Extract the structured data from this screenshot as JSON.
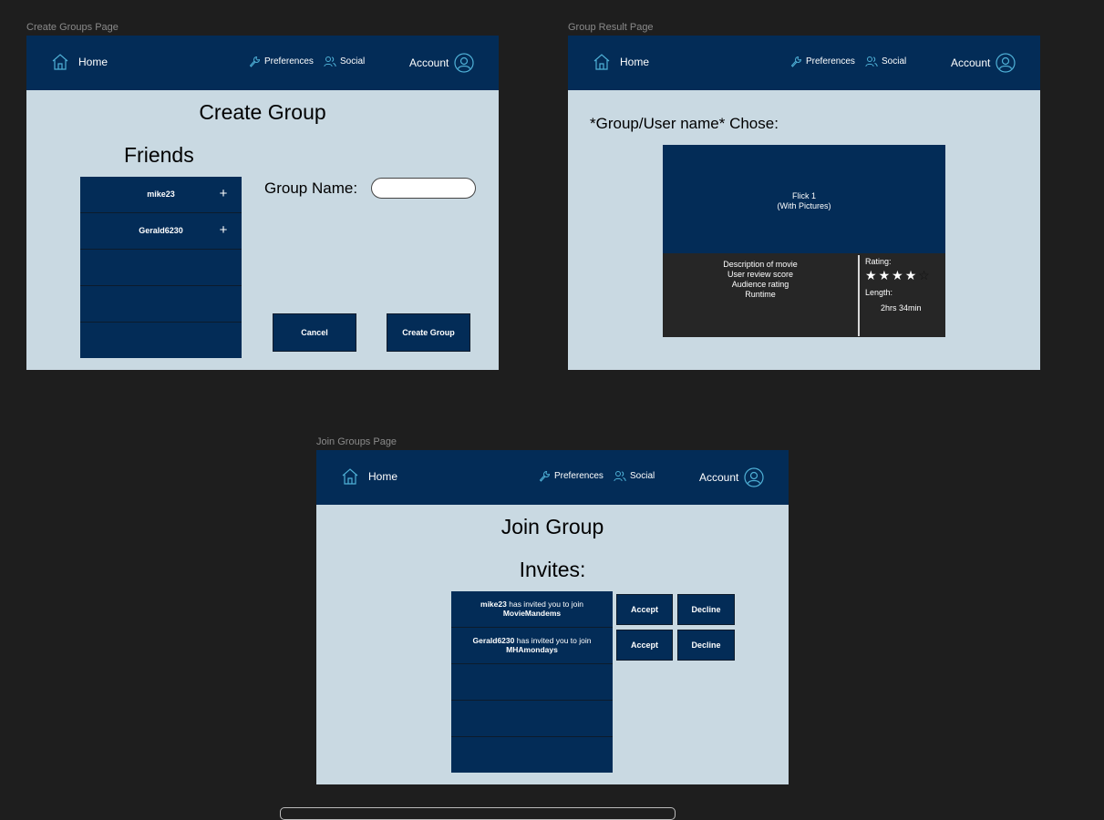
{
  "nav": {
    "home": "Home",
    "preferences": "Preferences",
    "social": "Social",
    "account": "Account"
  },
  "create_page": {
    "frame_label": "Create Groups Page",
    "title": "Create Group",
    "friends_heading": "Friends",
    "friends": [
      "mike23",
      "Gerald6230",
      "",
      "",
      ""
    ],
    "add_icon": "plus-icon",
    "group_name_label": "Group Name:",
    "group_name_value": "",
    "cancel_label": "Cancel",
    "create_label": "Create Group"
  },
  "result_page": {
    "frame_label": "Group Result Page",
    "chose_text": "*Group/User name* Chose:",
    "flick_title": "Flick 1",
    "flick_subtitle": "(With Pictures)",
    "description_lines": [
      "Description of movie",
      "User review score",
      "Audience rating",
      "Runtime"
    ],
    "rating_label": "Rating:",
    "rating": 4,
    "rating_max": 5,
    "length_label": "Length:",
    "length": "2hrs 34min"
  },
  "join_page": {
    "frame_label": "Join Groups Page",
    "title": "Join Group",
    "invites_heading": "Invites:",
    "invites": [
      {
        "user": "mike23",
        "text": "has invited you to join",
        "group": "MovieMandems",
        "accept": "Accept",
        "decline": "Decline"
      },
      {
        "user": "Gerald6230",
        "text": "has invited you to join",
        "group": "MHAmondays",
        "accept": "Accept",
        "decline": "Decline"
      }
    ]
  },
  "colors": {
    "nav": "#032c57",
    "frame_bg": "#c9d9e2",
    "canvas": "#1e1e1e",
    "icon_accent": "#4fb0d6"
  }
}
